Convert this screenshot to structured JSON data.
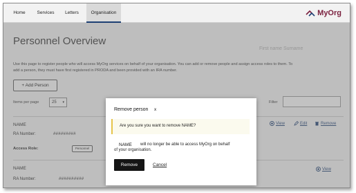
{
  "nav": {
    "items": [
      {
        "label": "Home"
      },
      {
        "label": "Services"
      },
      {
        "label": "Letters"
      },
      {
        "label": "Organisation"
      }
    ],
    "brand": "MyOrg"
  },
  "page": {
    "title": "Personnel Overview",
    "user_name_placeholder": "First name Surname",
    "intro_line1": "Use this page to register people who will access MyOrg services on behalf of your organisation. You can add or remove people and assign access roles to them. To",
    "intro_line2": "add a person, they must have first registered in PRODA and been provided with an IRA number.",
    "add_person_label": "+ Add Person",
    "items_per_page_label": "Items per page",
    "items_per_page_value": "25",
    "filter_label": "Filter"
  },
  "records": [
    {
      "name": "NAME",
      "ra_label": "RA Number:",
      "ra_value": "#########",
      "role_label": "Access Role:",
      "role_value": "Personnel",
      "view": "View",
      "edit": "Edit",
      "remove": "Remove"
    },
    {
      "name": "NAME",
      "ra_label": "RA Number:",
      "ra_value": "##########",
      "view": "View"
    }
  ],
  "modal": {
    "title": "Remove person",
    "close": "x",
    "confirm_text": "Are you sure you want to remove NAME?",
    "warn_name": "NAME",
    "warn_line1": "will no longer be able to access MyOrg on behalf",
    "warn_line2": "of your organisation.",
    "remove_label": "Remove",
    "cancel_label": "Cancel"
  },
  "colors": {
    "brand": "#7a1f3d",
    "link": "#1d3f73",
    "primary_button": "#151515",
    "confirm_bg": "#fbfaee",
    "confirm_border": "#e6c44a"
  }
}
